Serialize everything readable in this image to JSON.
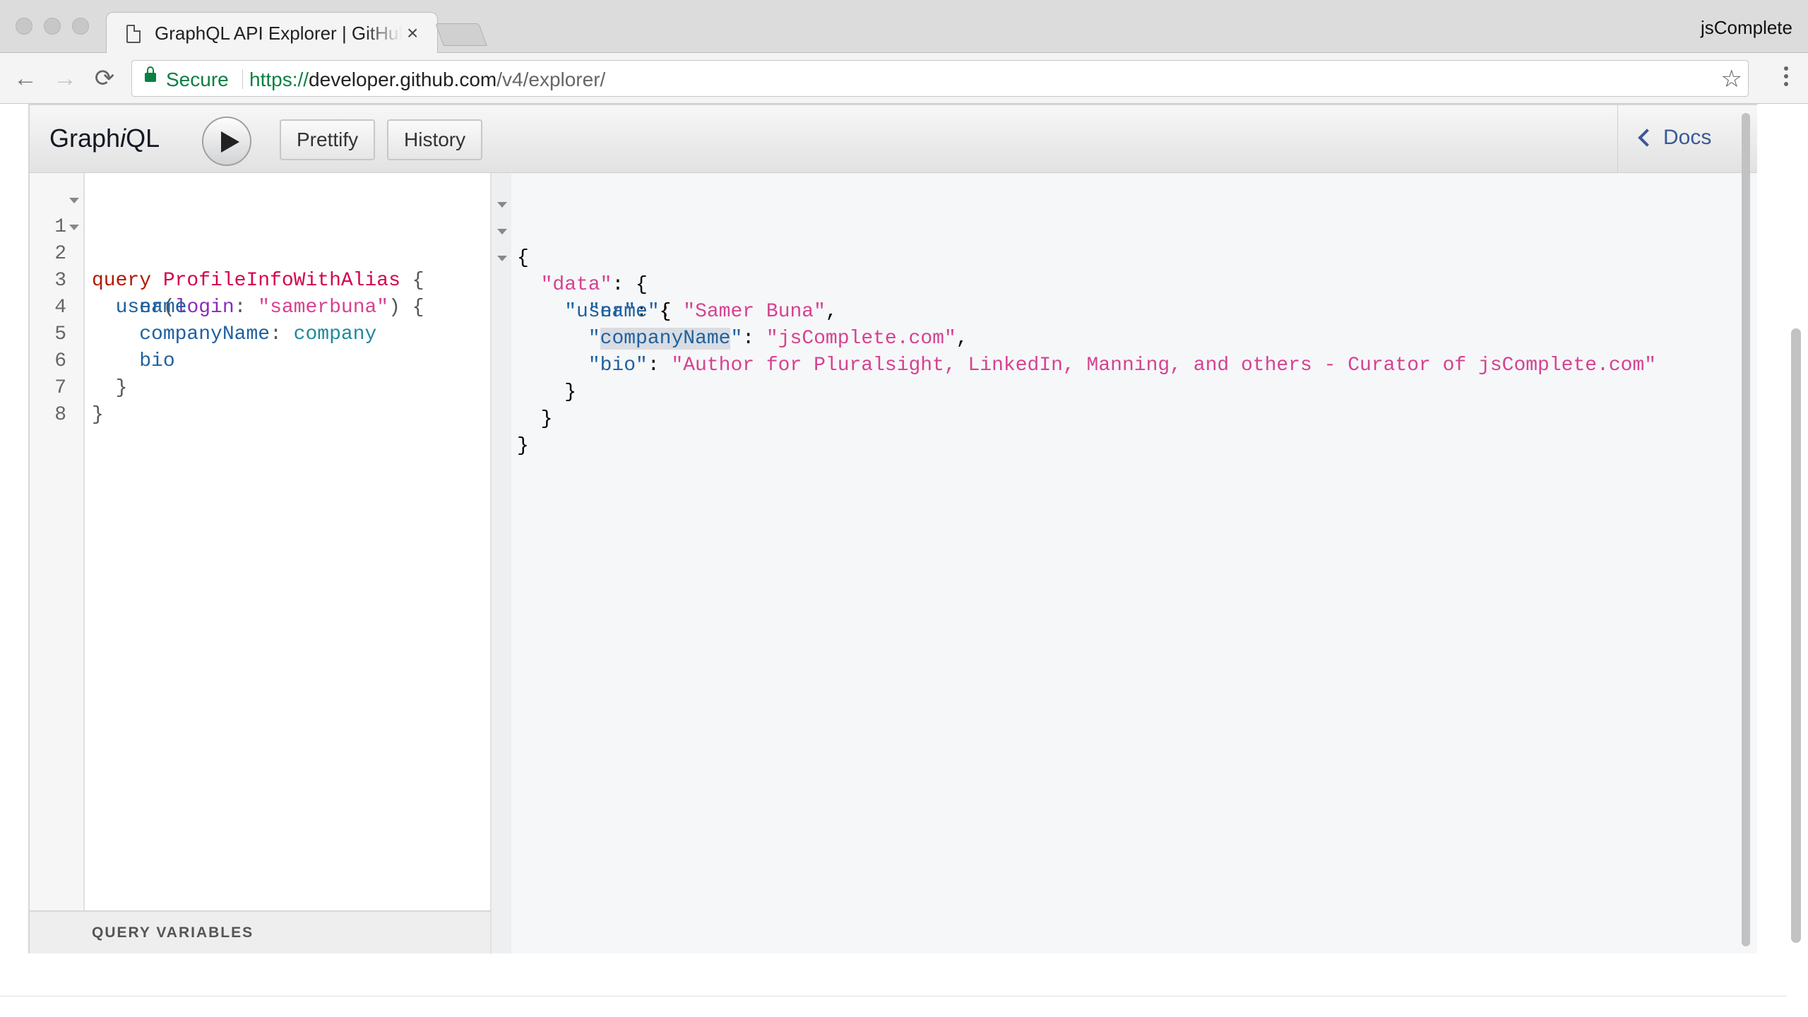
{
  "browser": {
    "tab_title": "GraphQL API Explorer | GitHub",
    "tab_close": "×",
    "profile_name": "jsComplete",
    "back_icon": "←",
    "forward_icon": "→",
    "reload_icon": "⟳",
    "security_label": "Secure",
    "url_scheme": "https://",
    "url_host": "developer.github.com",
    "url_path": "/v4/explorer/",
    "bookmark_icon": "☆"
  },
  "graphiql": {
    "title_prefix": "Graph",
    "title_italic": "i",
    "title_suffix": "QL",
    "prettify_label": "Prettify",
    "history_label": "History",
    "docs_label": "Docs",
    "query_variables_label": "QUERY VARIABLES"
  },
  "query_editor": {
    "lines": [
      {
        "num": "1",
        "kw": "query",
        "name": "ProfileInfoWithAlias",
        "brace": "{"
      },
      {
        "num": "2",
        "field": "user",
        "paren_open": "(",
        "arg": "login",
        "colon": ": ",
        "value": "\"samerbuna\"",
        "paren_close": ")",
        "brace": "{"
      },
      {
        "num": "3",
        "field": "name"
      },
      {
        "num": "4",
        "alias": "companyName",
        "colon": ": ",
        "field": "company"
      },
      {
        "num": "5",
        "field": "bio"
      },
      {
        "num": "6",
        "brace": "}"
      },
      {
        "num": "7",
        "brace": "}"
      },
      {
        "num": "8"
      }
    ]
  },
  "result": {
    "open": "{",
    "data_key": "\"data\"",
    "user_key": "\"user\"",
    "name_key": "\"name\"",
    "name_value": "\"Samer Buna\"",
    "company_quote": "\"",
    "company_key": "companyName",
    "company_value": "\"jsComplete.com\"",
    "bio_key": "\"bio\"",
    "bio_value": "\"Author for Pluralsight, LinkedIn, Manning, and others - Curator of jsComplete.com\"",
    "close": "}",
    "colon": ": ",
    "comma": ","
  }
}
